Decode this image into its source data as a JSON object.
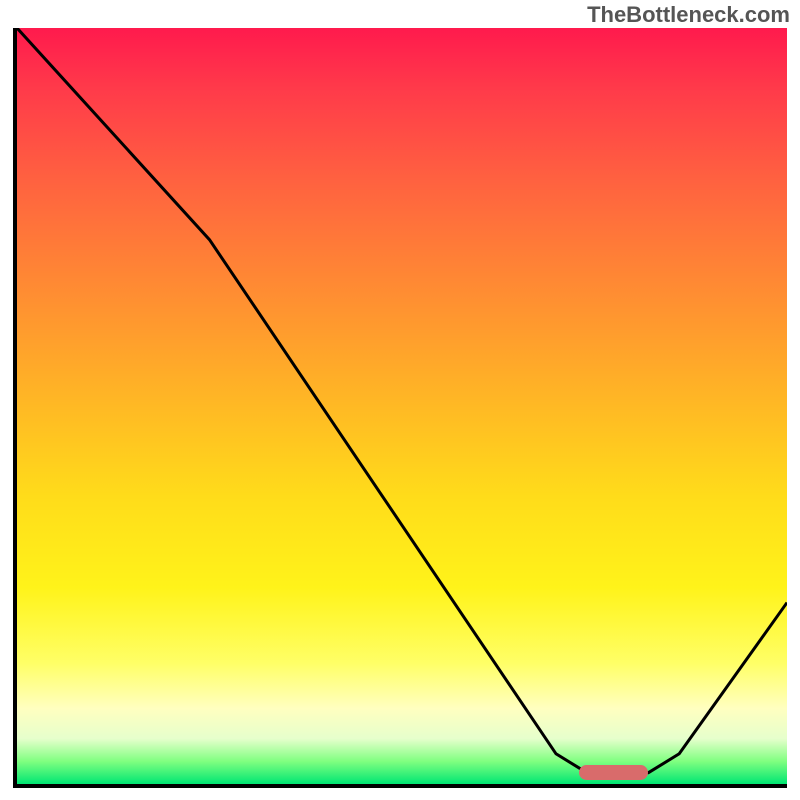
{
  "watermark": "TheBottleneck.com",
  "chart_data": {
    "type": "line",
    "title": "",
    "xlabel": "",
    "ylabel": "",
    "xlim": [
      0,
      100
    ],
    "ylim": [
      0,
      100
    ],
    "grid": false,
    "curve_points": [
      {
        "x": 0.0,
        "y": 100.0
      },
      {
        "x": 25.0,
        "y": 72.0
      },
      {
        "x": 70.0,
        "y": 4.0
      },
      {
        "x": 74.0,
        "y": 1.5
      },
      {
        "x": 82.0,
        "y": 1.5
      },
      {
        "x": 86.0,
        "y": 4.0
      },
      {
        "x": 100.0,
        "y": 24.0
      }
    ],
    "marker": {
      "x": 77.5,
      "y": 1.5,
      "width_pct": 9,
      "height_pct": 2
    },
    "gradient_stops": [
      {
        "pos": 0.0,
        "color": "#ff1a4d"
      },
      {
        "pos": 0.5,
        "color": "#ffc020"
      },
      {
        "pos": 0.85,
        "color": "#ffff80"
      },
      {
        "pos": 1.0,
        "color": "#00e673"
      }
    ]
  }
}
